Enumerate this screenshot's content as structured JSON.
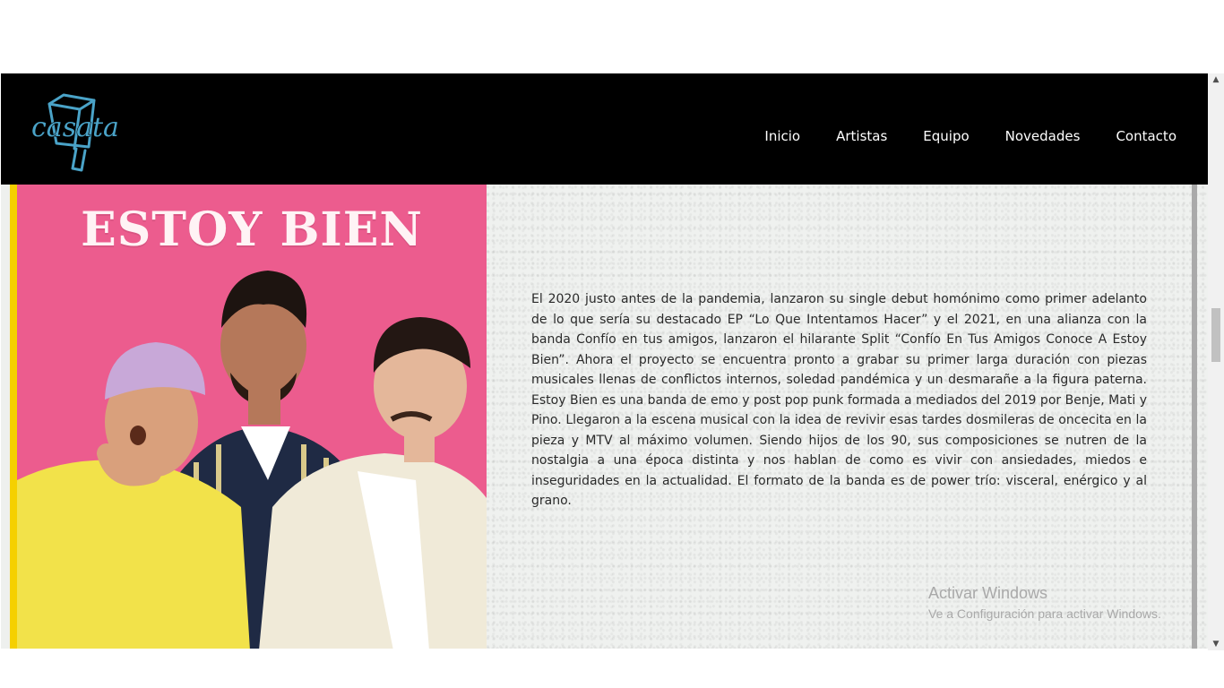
{
  "brand": {
    "logo_text": "casata",
    "logo_color": "#4aa3c8"
  },
  "nav": {
    "items": [
      "Inicio",
      "Artistas",
      "Equipo",
      "Novedades",
      "Contacto"
    ]
  },
  "artist": {
    "title": "ESTOY BIEN",
    "bio": "El 2020 justo antes de la pandemia, lanzaron su single debut homónimo como primer adelanto de lo que sería su destacado EP “Lo Que Intentamos Hacer” y el 2021, en una alianza con la banda Confío en tus amigos, lanzaron el hilarante Split “Confío En Tus Amigos Conoce A Estoy Bien”. Ahora el proyecto se encuentra pronto a grabar su primer larga duración con piezas musicales llenas de conflictos internos, soledad pandémica y un desmarañe a la figura paterna. Estoy Bien es una banda de emo y post pop punk formada a mediados del 2019 por Benje, Mati y Pino. Llegaron a la escena musical con la idea de revivir esas tardes dosmileras de oncecita en la pieza y MTV al máximo volumen. Siendo hijos de los 90, sus composiciones se nutren de la nostalgia a una época distinta y nos hablan de como es vivir con ansiedades, miedos e inseguridades en la actualidad. El formato de la banda es de power trío: visceral, enérgico y al grano."
  },
  "windows_watermark": {
    "line1": "Activar Windows",
    "line2": "Ve a Configuración para activar Windows."
  },
  "colors": {
    "header_bg": "#000000",
    "photo_bg": "#ec5c8e",
    "accent_stripe": "#f5d000",
    "text": "#2a2a2a"
  }
}
